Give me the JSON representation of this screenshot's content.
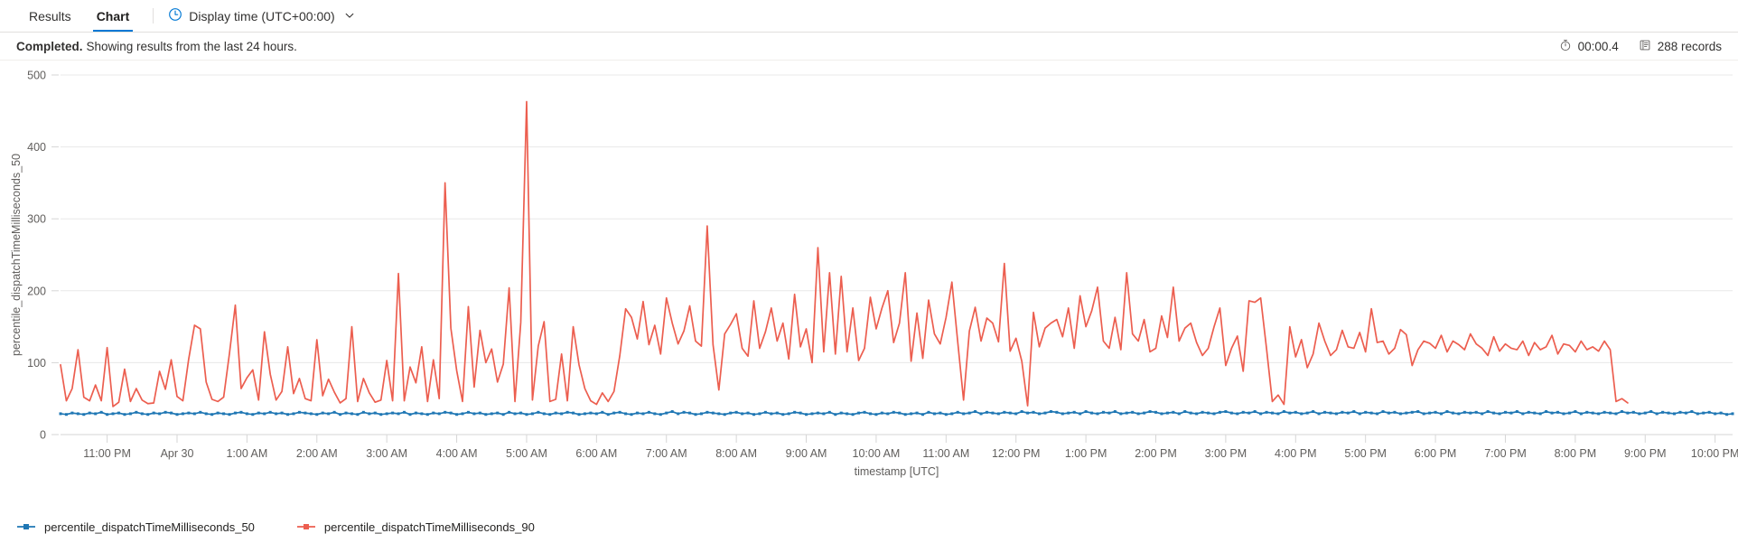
{
  "tabs": [
    {
      "label": "Results",
      "active": false
    },
    {
      "label": "Chart",
      "active": true
    }
  ],
  "toolbar": {
    "display_time_label": "Display time (UTC+00:00)",
    "clock_icon": "clock-icon",
    "chevron_icon": "chevron-down-icon"
  },
  "status": {
    "state": "Completed.",
    "message": "Showing results from the last 24 hours.",
    "duration": "00:00.4",
    "duration_icon": "stopwatch-icon",
    "records": "288 records",
    "records_icon": "records-icon"
  },
  "colors": {
    "accent": "#0078d4",
    "series_50": "#1f77b4",
    "series_90": "#ec5e4f",
    "grid": "#e8e8e8",
    "axis_text": "#605e5c"
  },
  "chart_data": {
    "type": "line",
    "title": "",
    "xlabel": "timestamp [UTC]",
    "ylabel": "percentile_dispatchTimeMilliseconds_50",
    "ylim": [
      0,
      500
    ],
    "yticks": [
      0,
      100,
      200,
      300,
      400,
      500
    ],
    "grid": true,
    "legend_position": "bottom-left",
    "xtick_labels": [
      "11:00 PM",
      "Apr 30",
      "1:00 AM",
      "2:00 AM",
      "3:00 AM",
      "4:00 AM",
      "5:00 AM",
      "6:00 AM",
      "7:00 AM",
      "8:00 AM",
      "9:00 AM",
      "10:00 AM",
      "11:00 AM",
      "12:00 PM",
      "1:00 PM",
      "2:00 PM",
      "3:00 PM",
      "4:00 PM",
      "5:00 PM",
      "6:00 PM",
      "7:00 PM",
      "8:00 PM",
      "9:00 PM",
      "10:00 PM"
    ],
    "xtick_index": [
      8,
      20,
      32,
      44,
      56,
      68,
      80,
      92,
      104,
      116,
      128,
      140,
      152,
      164,
      176,
      188,
      200,
      212,
      224,
      236,
      248,
      260,
      272,
      284
    ],
    "n_points": 288,
    "series": [
      {
        "name": "percentile_dispatchTimeMilliseconds_50",
        "color": "#1f77b4",
        "markers": true,
        "values": [
          29,
          28,
          30,
          29,
          28,
          30,
          29,
          31,
          28,
          29,
          30,
          28,
          29,
          31,
          29,
          28,
          30,
          29,
          31,
          30,
          28,
          29,
          30,
          29,
          31,
          29,
          28,
          30,
          29,
          28,
          30,
          31,
          29,
          28,
          30,
          29,
          31,
          29,
          30,
          28,
          29,
          31,
          30,
          29,
          28,
          30,
          29,
          31,
          28,
          30,
          29,
          28,
          31,
          29,
          30,
          28,
          29,
          30,
          29,
          31,
          28,
          30,
          29,
          28,
          30,
          29,
          31,
          30,
          28,
          29,
          31,
          29,
          30,
          28,
          29,
          30,
          28,
          31,
          29,
          30,
          28,
          29,
          31,
          29,
          28,
          30,
          29,
          31,
          30,
          28,
          29,
          30,
          29,
          31,
          28,
          30,
          31,
          29,
          28,
          30,
          29,
          31,
          29,
          28,
          30,
          32,
          29,
          31,
          30,
          28,
          29,
          31,
          30,
          29,
          28,
          30,
          31,
          29,
          30,
          28,
          29,
          31,
          29,
          30,
          28,
          29,
          31,
          30,
          28,
          29,
          30,
          29,
          31,
          28,
          30,
          29,
          28,
          30,
          31,
          29,
          28,
          30,
          29,
          31,
          30,
          28,
          29,
          30,
          28,
          31,
          29,
          30,
          28,
          29,
          31,
          29,
          30,
          32,
          29,
          31,
          30,
          29,
          31,
          30,
          29,
          32,
          30,
          31,
          29,
          30,
          32,
          31,
          29,
          30,
          31,
          29,
          32,
          30,
          29,
          31,
          30,
          32,
          29,
          30,
          31,
          29,
          30,
          32,
          31,
          29,
          30,
          31,
          29,
          32,
          30,
          29,
          31,
          30,
          29,
          31,
          32,
          30,
          29,
          31,
          30,
          32,
          29,
          31,
          30,
          29,
          32,
          30,
          31,
          29,
          30,
          32,
          29,
          31,
          30,
          29,
          31,
          30,
          32,
          29,
          31,
          30,
          29,
          32,
          30,
          31,
          29,
          30,
          31,
          32,
          29,
          30,
          31,
          29,
          32,
          30,
          29,
          31,
          30,
          31,
          29,
          32,
          30,
          29,
          31,
          30,
          32,
          29,
          31,
          30,
          29,
          32,
          30,
          31,
          29,
          30,
          32,
          29,
          31,
          30,
          29,
          31,
          30,
          29,
          32,
          30,
          31,
          29,
          30,
          32,
          29,
          31,
          30,
          29,
          31,
          30,
          32,
          29,
          30,
          31,
          29,
          30,
          28,
          29
        ]
      },
      {
        "name": "percentile_dispatchTimeMilliseconds_90",
        "color": "#ec5e4f",
        "markers": false,
        "values": [
          97,
          47,
          64,
          118,
          52,
          47,
          69,
          47,
          121,
          39,
          45,
          91,
          46,
          64,
          48,
          43,
          44,
          88,
          63,
          104,
          53,
          47,
          105,
          152,
          147,
          73,
          49,
          46,
          52,
          113,
          180,
          64,
          79,
          90,
          48,
          143,
          84,
          48,
          60,
          122,
          57,
          78,
          50,
          47,
          132,
          54,
          77,
          59,
          44,
          50,
          150,
          46,
          78,
          58,
          45,
          48,
          103,
          47,
          224,
          47,
          94,
          72,
          122,
          46,
          104,
          50,
          350,
          148,
          89,
          46,
          178,
          66,
          145,
          100,
          119,
          73,
          98,
          204,
          46,
          156,
          463,
          48,
          123,
          157,
          46,
          49,
          112,
          47,
          150,
          97,
          64,
          47,
          42,
          58,
          46,
          60,
          110,
          175,
          163,
          133,
          185,
          125,
          152,
          112,
          190,
          155,
          126,
          144,
          179,
          130,
          123,
          290,
          125,
          62,
          140,
          153,
          168,
          120,
          109,
          186,
          120,
          143,
          176,
          130,
          155,
          105,
          195,
          122,
          147,
          100,
          260,
          115,
          225,
          112,
          220,
          115,
          176,
          103,
          120,
          191,
          147,
          176,
          200,
          128,
          155,
          225,
          102,
          169,
          106,
          187,
          140,
          126,
          163,
          212,
          129,
          48,
          144,
          177,
          130,
          162,
          155,
          129,
          238,
          116,
          134,
          102,
          40,
          170,
          122,
          148,
          155,
          160,
          136,
          176,
          120,
          193,
          150,
          172,
          205,
          130,
          120,
          163,
          118,
          225,
          140,
          130,
          160,
          115,
          120,
          165,
          135,
          205,
          130,
          148,
          155,
          128,
          110,
          120,
          150,
          176,
          96,
          120,
          137,
          88,
          186,
          184,
          190,
          120,
          46,
          55,
          42,
          150,
          108,
          132,
          93,
          112,
          155,
          130,
          110,
          118,
          145,
          122,
          120,
          142,
          115,
          175,
          128,
          130,
          112,
          120,
          146,
          139,
          96,
          118,
          130,
          127,
          120,
          138,
          115,
          130,
          125,
          118,
          140,
          126,
          120,
          110,
          136,
          116,
          126,
          120,
          118,
          130,
          110,
          128,
          118,
          122,
          138,
          112,
          126,
          124,
          115,
          130,
          118,
          122,
          116,
          130,
          118,
          46,
          50,
          44
        ]
      }
    ]
  }
}
